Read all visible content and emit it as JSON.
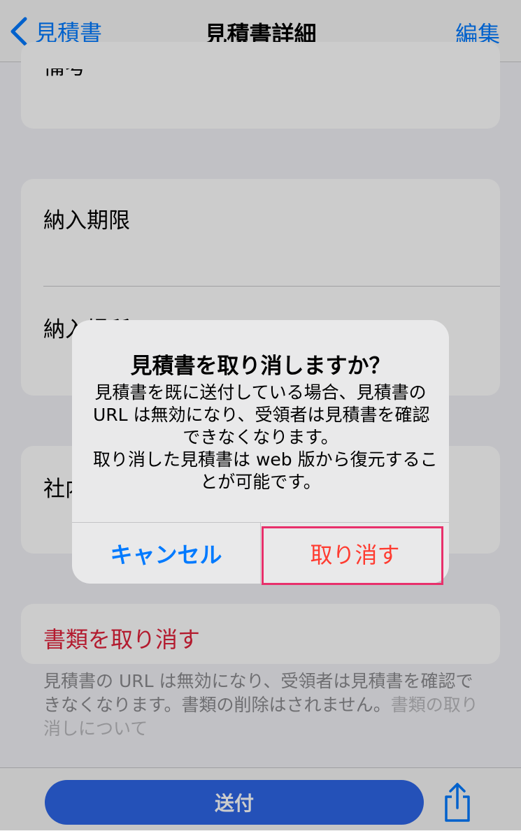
{
  "nav": {
    "back_label": "見積書",
    "title": "見積書詳細",
    "edit_label": "編集"
  },
  "form": {
    "remarks_label": "備考",
    "delivery_deadline_label": "納入期限",
    "delivery_place_label": "納入場所",
    "internal_memo_label": "社内メモ"
  },
  "cancel_section": {
    "button_label": "書類を取り消す",
    "footnote_text": "見積書の URL は無効になり、受領者は見積書を確認できなくなります。書類の削除はされません。",
    "footnote_link": "書類の取り消しについて"
  },
  "bottom": {
    "send_label": "送付",
    "share_icon": "share-icon"
  },
  "alert": {
    "title": "見積書を取り消しますか？",
    "message_lines": [
      "見積書を既に送付している場合、見積書の",
      "URL は無効になり、受領者は見積書を確認",
      "できなくなります。",
      "取り消した見積書は web 版から復元するこ",
      "とが可能です。"
    ],
    "cancel_label": "キャンセル",
    "destroy_label": "取り消す"
  },
  "colors": {
    "accent": "#007aff",
    "destructive": "#ff3b30",
    "danger_text": "#e0213a",
    "send_button": "#2e66e6",
    "highlight": "#e8306b"
  }
}
